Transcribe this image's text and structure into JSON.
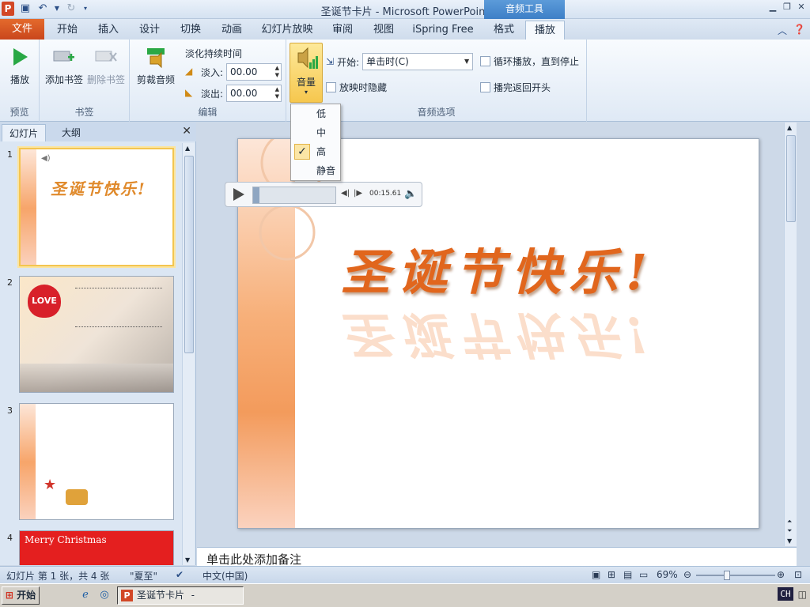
{
  "window": {
    "title": "圣诞节卡片 - Microsoft PowerPoint",
    "context_tab_title": "音频工具"
  },
  "ribbon_tabs": [
    "文件",
    "开始",
    "插入",
    "设计",
    "切换",
    "动画",
    "幻灯片放映",
    "审阅",
    "视图",
    "iSpring Free",
    "格式",
    "播放"
  ],
  "active_tab": "播放",
  "ribbon": {
    "preview": {
      "play_label": "播放",
      "group_label": "预览"
    },
    "bookmarks": {
      "add_label": "添加书签",
      "remove_label": "删除书签",
      "group_label": "书签"
    },
    "editing": {
      "trim_label": "剪裁音频",
      "fade_duration_label": "淡化持续时间",
      "fade_in_label": "淡入:",
      "fade_in_value": "00.00",
      "fade_out_label": "淡出:",
      "fade_out_value": "00.00",
      "group_label": "编辑"
    },
    "audio_options": {
      "volume_label": "音量",
      "start_label": "开始:",
      "start_value": "单击时(C)",
      "hide_label": "放映时隐藏",
      "loop_label": "循环播放，直到停止",
      "rewind_label": "播完返回开头",
      "group_label": "音频选项"
    }
  },
  "volume_menu": {
    "items": [
      "低",
      "中",
      "高",
      "静音"
    ],
    "checked_item": "高"
  },
  "slides_panel": {
    "tabs": [
      "幻灯片",
      "大纲"
    ],
    "slide_numbers": [
      "1",
      "2",
      "3",
      "4"
    ],
    "thumb1_text": "圣诞节快乐!",
    "thumb2_love": "LOVE",
    "thumb4_text": "Merry Christmas"
  },
  "slide": {
    "headline": "圣诞节快乐!"
  },
  "audio_player": {
    "time": "00:15.61",
    "progress": 0.08
  },
  "notes": {
    "placeholder": "单击此处添加备注"
  },
  "status": {
    "slide_info": "幻灯片 第 1 张，共 4 张",
    "theme": "\"夏至\"",
    "language": "中文(中国)",
    "zoom": "69%",
    "zoom_level": 0.69
  },
  "taskbar": {
    "start_label": "开始",
    "task_label": "圣诞节卡片 - Micros...",
    "ime": "CH"
  }
}
